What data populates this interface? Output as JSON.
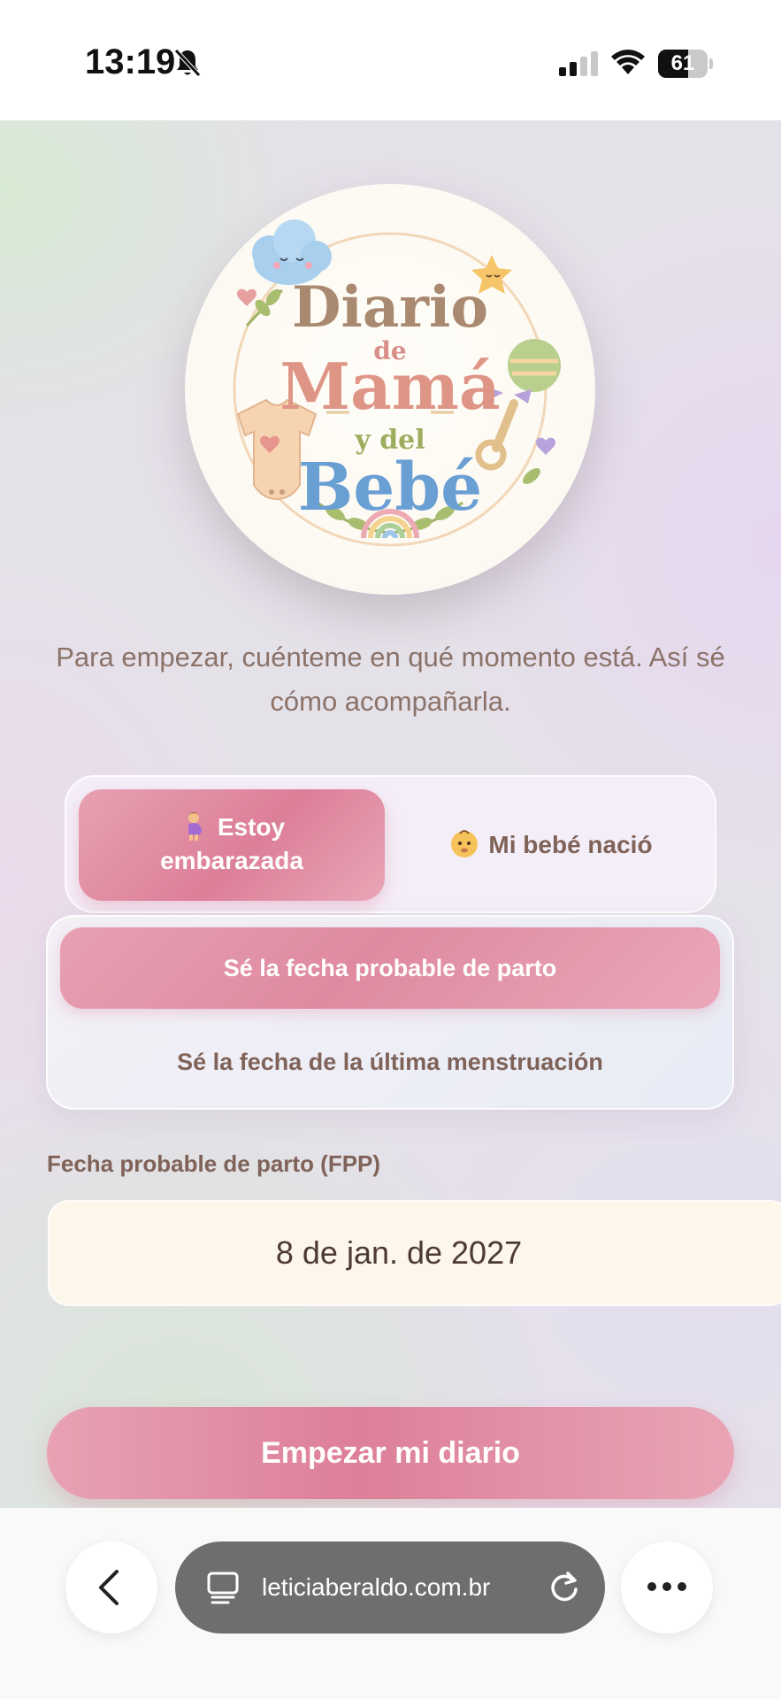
{
  "status_bar": {
    "time": "13:19",
    "battery_percent": 61,
    "battery_label": "61",
    "icons": [
      "bell-slash-icon",
      "signal-icon",
      "wifi-icon",
      "battery-icon"
    ]
  },
  "logo": {
    "line1": "Diario",
    "line2": "de",
    "line3": "Mamá",
    "line4": "y del",
    "line5": "Bebé"
  },
  "intro": {
    "text": "Para empezar, cuénteme en qué momento está. Así sé cómo acompañarla."
  },
  "mode_selector": {
    "options": [
      {
        "label_line1": "Estoy",
        "label_line2": "embarazada",
        "icon": "pregnant-woman-emoji",
        "selected": true
      },
      {
        "label": "Mi bebé nació",
        "icon": "baby-emoji",
        "selected": false
      }
    ]
  },
  "date_type": {
    "options": [
      {
        "label": "Sé la fecha probable de parto",
        "selected": true
      },
      {
        "label": "Sé la fecha de la última menstruación",
        "selected": false
      }
    ]
  },
  "due_date": {
    "label": "Fecha probable de parto (FPP)",
    "value": "8 de jan. de 2027"
  },
  "primary_action": {
    "label": "Empezar mi diario"
  },
  "browser": {
    "url": "leticiaberaldo.com.br",
    "icons": [
      "back-chevron-icon",
      "tabs-icon",
      "reload-icon",
      "more-icon"
    ]
  },
  "colors": {
    "accent_pink": "#dd7f99",
    "text_brown": "#7f6258",
    "date_field_bg": "#fdf6ea"
  }
}
